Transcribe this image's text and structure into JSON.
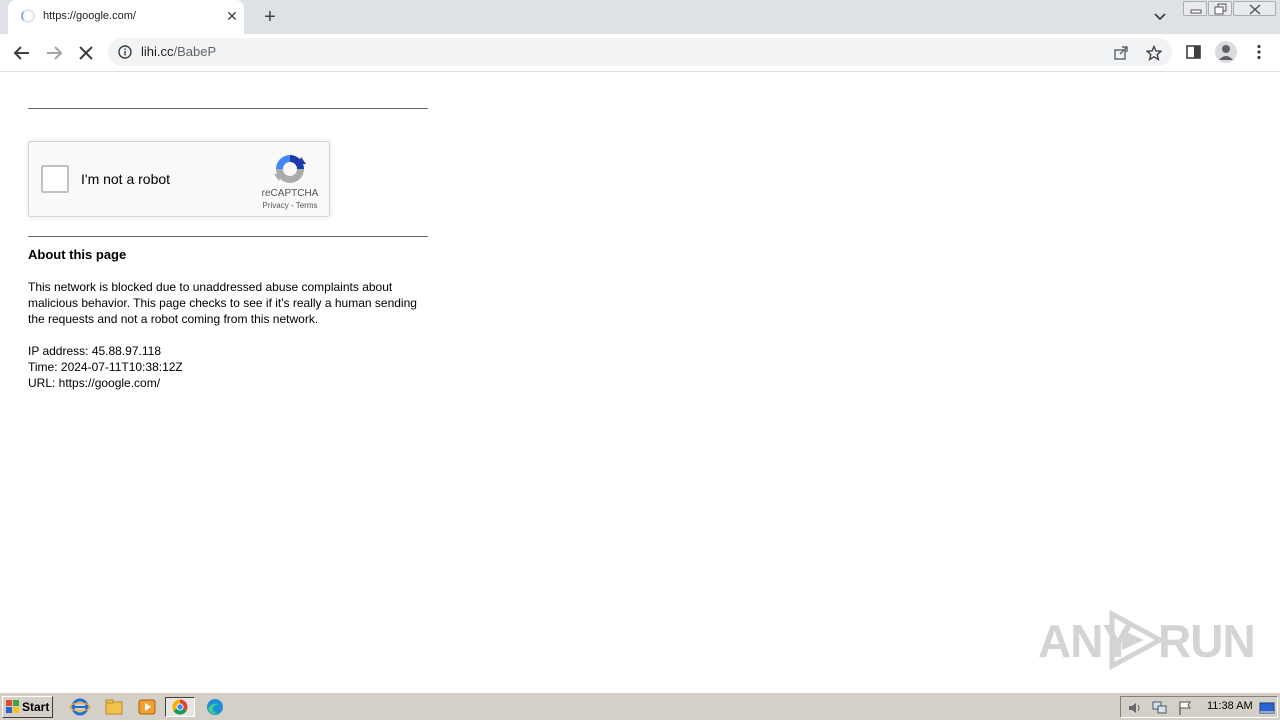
{
  "tab": {
    "title": "https://google.com/",
    "close_label": "✕"
  },
  "newtab_label": "+",
  "omnibox": {
    "host": "lihi.cc",
    "path": "/BabeP"
  },
  "captcha": {
    "label": "I'm not a robot",
    "brand": "reCAPTCHA",
    "privacy": "Privacy",
    "separator": " - ",
    "terms": "Terms"
  },
  "about": {
    "title": "About this page",
    "text": "This network is blocked due to unaddressed abuse complaints about malicious behavior. This page checks to see if it's really a human sending the requests and not a robot coming from this network.",
    "ip": "IP address: 45.88.97.118",
    "time": "Time: 2024-07-11T10:38:12Z",
    "url": "URL: https://google.com/"
  },
  "watermark": {
    "left": "ANY",
    "right": "RUN"
  },
  "taskbar": {
    "start_label": "Start",
    "clock": "11:38 AM",
    "apps": [
      "internet-explorer-icon",
      "file-explorer-icon",
      "media-player-icon",
      "chrome-icon",
      "edge-icon"
    ]
  },
  "colors": {
    "tabstrip": "#dee1e6",
    "omnibox": "#f1f3f4",
    "recaptcha_blue": "#1c3aa9",
    "recaptcha_lightblue": "#4285f4",
    "recaptcha_gray": "#ababab",
    "taskbar": "#d4d0c8"
  }
}
